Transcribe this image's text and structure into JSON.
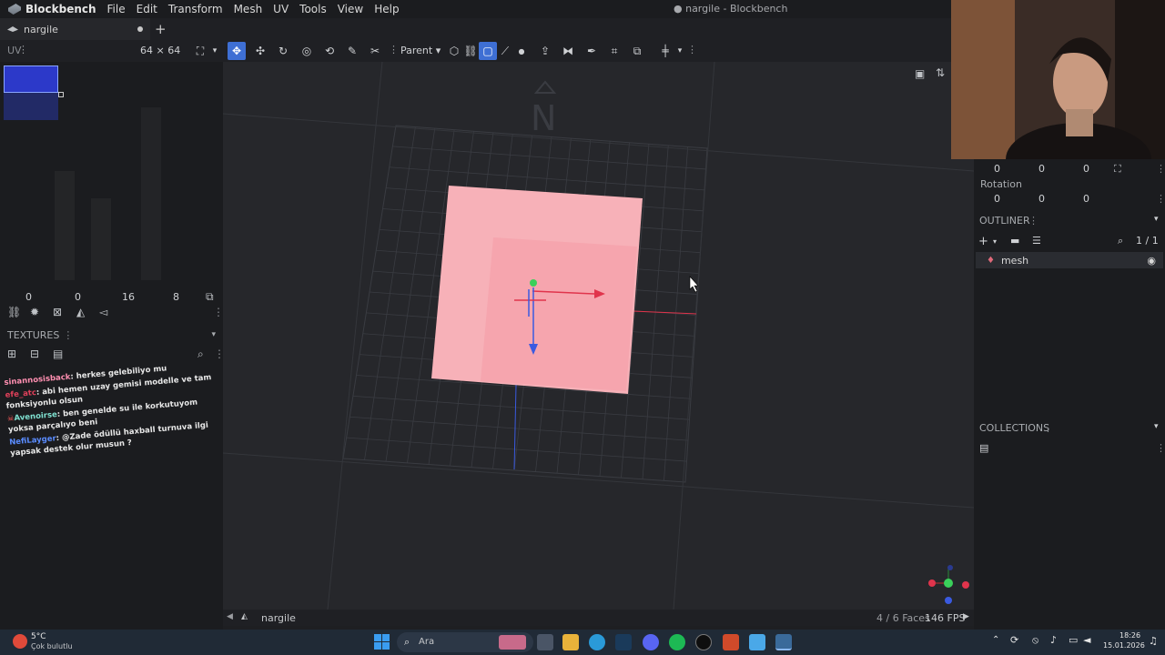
{
  "app": {
    "name": "Blockbench",
    "window_title": "● nargile - Blockbench",
    "menu": [
      "File",
      "Edit",
      "Transform",
      "Mesh",
      "UV",
      "Tools",
      "View",
      "Help"
    ]
  },
  "tabs": [
    {
      "label": "nargile"
    }
  ],
  "toolbar": {
    "uv_label": "UV",
    "resolution": "64 × 64",
    "pivot_mode": "Parent"
  },
  "uv_panel": {
    "coords": [
      "0",
      "0",
      "16",
      "8"
    ]
  },
  "textures": {
    "header": "TEXTURES"
  },
  "chat": [
    {
      "user": "sinannosisback",
      "text": "herkes gelebiliyo mu",
      "user_color": "#ff8fb1"
    },
    {
      "user": "efe_atc",
      "text": "abi hemen uzay gemisi modelle ve tam fonksiyonlu olsun",
      "user_color": "#e0405a"
    },
    {
      "user": "Avenoirse",
      "text": "ben geneldе su ile korkutuyom yoksa parçalıyo beni",
      "user_color": "#7fe0d0"
    },
    {
      "user": "NefiLayger",
      "text": "@Zade ödüllü haxball turnuva ilgi yapsak destek olur musun ?",
      "user_color": "#5a8cff"
    }
  ],
  "viewport": {
    "compass": "N",
    "breadcrumb": "nargile",
    "faces": "4 / 6 Faces",
    "fps": "146 FPS"
  },
  "properties": {
    "position": [
      "0",
      "0",
      "0"
    ],
    "rotation_label": "Rotation",
    "rotation": [
      "0",
      "0",
      "0"
    ]
  },
  "outliner": {
    "header": "OUTLINER",
    "count": "1 / 1",
    "items": [
      {
        "label": "mesh"
      }
    ]
  },
  "collections": {
    "header": "COLLECTIONS"
  },
  "taskbar": {
    "temperature": "5°C",
    "weather": "Çok bulutlu",
    "search_placeholder": "Ara",
    "time": "18:26",
    "date": "15.01.2026"
  },
  "colors": {
    "accent": "#3e6fd4",
    "face": "#f7a8b0",
    "x_axis": "#e0344c",
    "y_axis": "#3ad05a",
    "z_axis": "#3a5ae0"
  }
}
